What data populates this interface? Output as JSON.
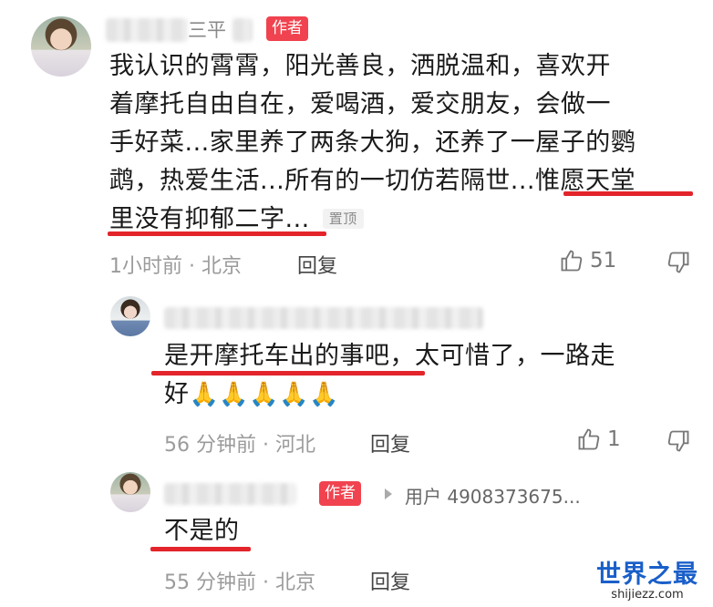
{
  "comment": {
    "name": "三平",
    "author_badge": "作者",
    "text_lines": [
      "我认识的霄霄，阳光善良，洒脱温和，喜欢开",
      "着摩托自由自在，爱喝酒，爱交朋友，会做一",
      "手好菜...家里养了两条大狗，还养了一屋子的鹦",
      "鹉，热爱生活...所有的一切仿若隔世...惟愿天堂",
      "里没有抑郁二字..."
    ],
    "pinned_label": "置顶",
    "time_location": "1小时前 · 北京",
    "reply_label": "回复",
    "likes": "51"
  },
  "reply1": {
    "text_line1": "是开摩托车出的事吧，太可惜了，一路走",
    "text_line2": "好",
    "emoji": "🙏🙏🙏🙏🙏",
    "time_location": "56 分钟前 · 河北",
    "reply_label": "回复",
    "likes": "1"
  },
  "reply2": {
    "author_badge": "作者",
    "reply_to": "用户 4908373675...",
    "text": "不是的",
    "time_location": "55 分钟前 · 北京",
    "reply_label": "回复"
  },
  "watermark": {
    "title": "世界之最",
    "url": "shijiezz.com"
  },
  "icons": [
    "thumbs-up-icon",
    "thumbs-down-icon",
    "triangle-right-icon"
  ],
  "colors": {
    "badge": "#f0434f",
    "underline": "#e3242b",
    "watermark": "#1a5fc9"
  }
}
